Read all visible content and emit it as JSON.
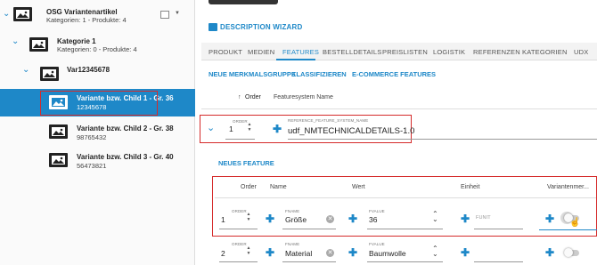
{
  "tree": {
    "root": {
      "title": "OSG Variantenartikel",
      "sub": "Kategorien: 1 - Produkte: 4"
    },
    "category": {
      "title": "Kategorie 1",
      "sub": "Kategorien: 0 - Produkte: 4"
    },
    "var": {
      "title": "Var12345678"
    },
    "children": [
      {
        "title": "Variante bzw. Child 1 - Gr. 36",
        "sub": "12345678"
      },
      {
        "title": "Variante bzw. Child 2 - Gr. 38",
        "sub": "98765432"
      },
      {
        "title": "Variante bzw. Child 3 - Gr. 40",
        "sub": "56473821"
      }
    ]
  },
  "wizard": {
    "label": "DESCRIPTION WIZARD"
  },
  "tabs": [
    "PRODUKT",
    "MEDIEN",
    "FEATURES",
    "BESTELLDETAILS",
    "PREISLISTEN",
    "LOGISTIK",
    "REFERENZEN",
    "KATEGORIEN",
    "UDX"
  ],
  "actions": [
    "NEUE MERKMALSGRUPPE",
    "KLASSIFIZIEREN",
    "E-COMMERCE FEATURES"
  ],
  "group_header": {
    "sort_arrow": "↑",
    "order": "Order",
    "system": "Featuresystem Name"
  },
  "group": {
    "order_label": "ORDER",
    "order": "1",
    "name_label": "REFERENCE_FEATURE_SYSTEM_NAME",
    "name": "udf_NMTECHNICALDETAILS-1.0"
  },
  "new_feature": "NEUES FEATURE",
  "feat_header": {
    "order": "Order",
    "name": "Name",
    "wert": "Wert",
    "einheit": "Einheit",
    "variant": "Variantenmer..."
  },
  "features": [
    {
      "order_label": "ORDER",
      "order": "1",
      "name_label": "FNAME",
      "name": "Größe",
      "value_label": "FVALUE",
      "value": "36",
      "unit_label": "FUNIT",
      "unit": ""
    },
    {
      "order_label": "ORDER",
      "order": "2",
      "name_label": "FNAME",
      "name": "Material",
      "value_label": "FVALUE",
      "value": "Baumwolle",
      "unit_label": "",
      "unit": ""
    }
  ],
  "colors": {
    "accent": "#1e88c8",
    "highlight": "#d52b2b"
  }
}
